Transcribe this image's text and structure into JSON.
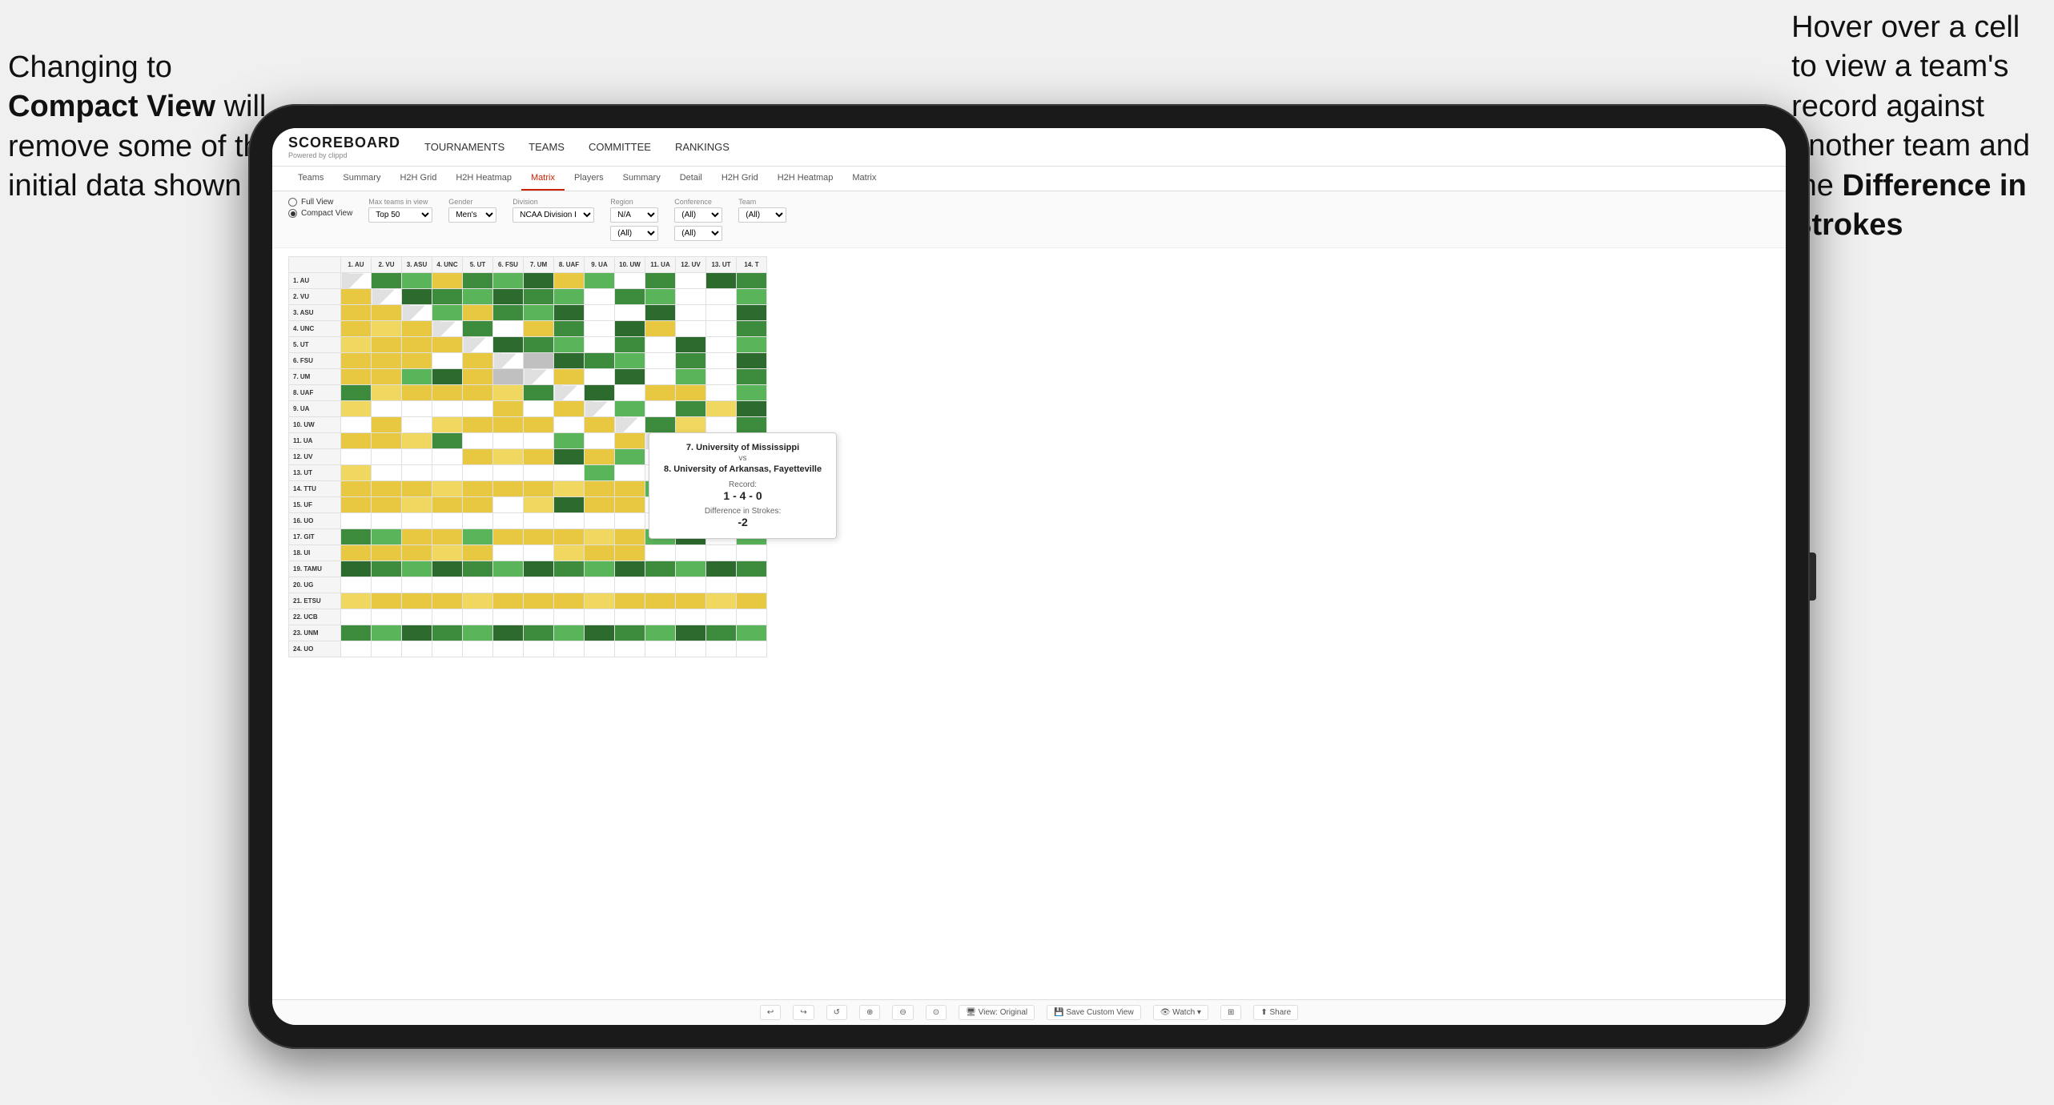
{
  "annotation_left": {
    "line1": "Changing to",
    "line2_bold": "Compact View",
    "line2_rest": " will",
    "line3": "remove some of the",
    "line4": "initial data shown"
  },
  "annotation_right": {
    "line1": "Hover over a cell",
    "line2": "to view a team's",
    "line3": "record against",
    "line4": "another team and",
    "line5_pre": "the ",
    "line5_bold": "Difference in",
    "line6_bold": "Strokes"
  },
  "logo": {
    "title": "SCOREBOARD",
    "subtitle": "Powered by clippd"
  },
  "top_nav": {
    "items": [
      "TOURNAMENTS",
      "TEAMS",
      "COMMITTEE",
      "RANKINGS"
    ]
  },
  "sub_nav": {
    "groups": [
      {
        "label": "Teams"
      },
      {
        "label": "Summary"
      },
      {
        "label": "H2H Grid"
      },
      {
        "label": "H2H Heatmap"
      },
      {
        "label": "Matrix",
        "active": true
      },
      {
        "label": "Players"
      },
      {
        "label": "Summary"
      },
      {
        "label": "Detail"
      },
      {
        "label": "H2H Grid"
      },
      {
        "label": "H2H Heatmap"
      },
      {
        "label": "Matrix"
      }
    ]
  },
  "filters": {
    "view_options": {
      "full_view": "Full View",
      "compact_view": "Compact View",
      "selected": "compact"
    },
    "max_teams": {
      "label": "Max teams in view",
      "value": "Top 50"
    },
    "gender": {
      "label": "Gender",
      "value": "Men's"
    },
    "division": {
      "label": "Division",
      "value": "NCAA Division I"
    },
    "region": {
      "label": "Region",
      "options": [
        "N/A",
        "(All)"
      ],
      "value1": "N/A",
      "value2": "(All)"
    },
    "conference": {
      "label": "Conference",
      "options": [
        "(All)",
        "(All)"
      ],
      "value1": "(All)",
      "value2": "(All)"
    },
    "team": {
      "label": "Team",
      "value": "(All)"
    }
  },
  "matrix": {
    "col_headers": [
      "1. AU",
      "2. VU",
      "3. ASU",
      "4. UNC",
      "5. UT",
      "6. FSU",
      "7. UM",
      "8. UAF",
      "9. UA",
      "10. UW",
      "11. UA",
      "12. UV",
      "13. UT",
      "14. T"
    ],
    "rows": [
      {
        "label": "1. AU",
        "cells": [
          "diag",
          "green",
          "green",
          "yellow",
          "green",
          "green",
          "green",
          "yellow",
          "green",
          "white",
          "green",
          "white",
          "green",
          "green"
        ]
      },
      {
        "label": "2. VU",
        "cells": [
          "yellow",
          "diag",
          "green",
          "green",
          "green",
          "green",
          "green",
          "green",
          "white",
          "green",
          "green",
          "white",
          "white",
          "green"
        ]
      },
      {
        "label": "3. ASU",
        "cells": [
          "yellow",
          "yellow",
          "diag",
          "green",
          "yellow",
          "green",
          "green",
          "green",
          "white",
          "white",
          "green",
          "white",
          "white",
          "green"
        ]
      },
      {
        "label": "4. UNC",
        "cells": [
          "yellow",
          "yellow",
          "yellow",
          "diag",
          "green",
          "white",
          "yellow",
          "green",
          "white",
          "green",
          "yellow",
          "white",
          "white",
          "green"
        ]
      },
      {
        "label": "5. UT",
        "cells": [
          "yellow",
          "yellow",
          "yellow",
          "yellow",
          "diag",
          "green",
          "green",
          "green",
          "white",
          "green",
          "white",
          "green",
          "white",
          "green"
        ]
      },
      {
        "label": "6. FSU",
        "cells": [
          "yellow",
          "yellow",
          "yellow",
          "white",
          "yellow",
          "diag",
          "gray",
          "green",
          "green",
          "green",
          "white",
          "green",
          "white",
          "green"
        ]
      },
      {
        "label": "7. UM",
        "cells": [
          "yellow",
          "yellow",
          "green",
          "green",
          "yellow",
          "gray",
          "diag",
          "yellow",
          "white",
          "green",
          "white",
          "green",
          "white",
          "green"
        ]
      },
      {
        "label": "8. UAF",
        "cells": [
          "green",
          "yellow",
          "yellow",
          "yellow",
          "yellow",
          "yellow",
          "green",
          "diag",
          "green",
          "white",
          "yellow",
          "yellow",
          "white",
          "green"
        ]
      },
      {
        "label": "9. UA",
        "cells": [
          "yellow",
          "white",
          "white",
          "white",
          "white",
          "yellow",
          "white",
          "yellow",
          "diag",
          "green",
          "white",
          "green",
          "yellow",
          "green"
        ]
      },
      {
        "label": "10. UW",
        "cells": [
          "white",
          "yellow",
          "white",
          "yellow",
          "yellow",
          "yellow",
          "yellow",
          "white",
          "yellow",
          "diag",
          "green",
          "yellow",
          "white",
          "green"
        ]
      },
      {
        "label": "11. UA",
        "cells": [
          "yellow",
          "yellow",
          "yellow",
          "green",
          "white",
          "white",
          "white",
          "green",
          "white",
          "yellow",
          "diag",
          "white",
          "white",
          "green"
        ]
      },
      {
        "label": "12. UV",
        "cells": [
          "white",
          "white",
          "white",
          "white",
          "yellow",
          "yellow",
          "yellow",
          "green",
          "yellow",
          "green",
          "white",
          "diag",
          "white",
          "yellow"
        ]
      },
      {
        "label": "13. UT",
        "cells": [
          "yellow",
          "white",
          "white",
          "white",
          "white",
          "white",
          "white",
          "white",
          "green",
          "white",
          "white",
          "white",
          "diag",
          "green"
        ]
      },
      {
        "label": "14. TTU",
        "cells": [
          "yellow",
          "yellow",
          "yellow",
          "yellow",
          "yellow",
          "yellow",
          "yellow",
          "yellow",
          "yellow",
          "yellow",
          "green",
          "white",
          "green",
          "diag"
        ]
      },
      {
        "label": "15. UF",
        "cells": [
          "yellow",
          "yellow",
          "yellow",
          "yellow",
          "yellow",
          "white",
          "yellow",
          "green",
          "yellow",
          "yellow",
          "white",
          "white",
          "white",
          "green"
        ]
      },
      {
        "label": "16. UO",
        "cells": [
          "white",
          "white",
          "white",
          "white",
          "white",
          "white",
          "white",
          "white",
          "white",
          "white",
          "white",
          "white",
          "white",
          "white"
        ]
      },
      {
        "label": "17. GIT",
        "cells": [
          "green",
          "green",
          "yellow",
          "yellow",
          "green",
          "yellow",
          "yellow",
          "yellow",
          "yellow",
          "yellow",
          "green",
          "green",
          "white",
          "green"
        ]
      },
      {
        "label": "18. UI",
        "cells": [
          "yellow",
          "yellow",
          "yellow",
          "yellow",
          "yellow",
          "white",
          "white",
          "yellow",
          "yellow",
          "yellow",
          "white",
          "white",
          "white",
          "white"
        ]
      },
      {
        "label": "19. TAMU",
        "cells": [
          "green",
          "green",
          "green",
          "green",
          "green",
          "green",
          "green",
          "green",
          "green",
          "green",
          "green",
          "green",
          "green",
          "green"
        ]
      },
      {
        "label": "20. UG",
        "cells": [
          "white",
          "white",
          "white",
          "white",
          "white",
          "white",
          "white",
          "white",
          "white",
          "white",
          "white",
          "white",
          "white",
          "white"
        ]
      },
      {
        "label": "21. ETSU",
        "cells": [
          "yellow",
          "yellow",
          "yellow",
          "yellow",
          "yellow",
          "yellow",
          "yellow",
          "yellow",
          "yellow",
          "yellow",
          "yellow",
          "yellow",
          "yellow",
          "yellow"
        ]
      },
      {
        "label": "22. UCB",
        "cells": [
          "white",
          "white",
          "white",
          "white",
          "white",
          "white",
          "white",
          "white",
          "white",
          "white",
          "white",
          "white",
          "white",
          "white"
        ]
      },
      {
        "label": "23. UNM",
        "cells": [
          "green",
          "green",
          "green",
          "green",
          "green",
          "green",
          "green",
          "green",
          "green",
          "green",
          "green",
          "green",
          "green",
          "green"
        ]
      },
      {
        "label": "24. UO",
        "cells": [
          "white",
          "white",
          "white",
          "white",
          "white",
          "white",
          "white",
          "white",
          "white",
          "white",
          "white",
          "white",
          "white",
          "white"
        ]
      }
    ]
  },
  "tooltip": {
    "team1": "7. University of Mississippi",
    "vs": "vs",
    "team2": "8. University of Arkansas, Fayetteville",
    "record_label": "Record:",
    "record": "1 - 4 - 0",
    "diff_label": "Difference in Strokes:",
    "diff": "-2"
  },
  "toolbar": {
    "buttons": [
      "↩",
      "↪",
      "⟳",
      "⊕",
      "⊖",
      "⊙",
      "View: Original",
      "Save Custom View",
      "Watch ▾",
      "⊞",
      "Share"
    ]
  }
}
